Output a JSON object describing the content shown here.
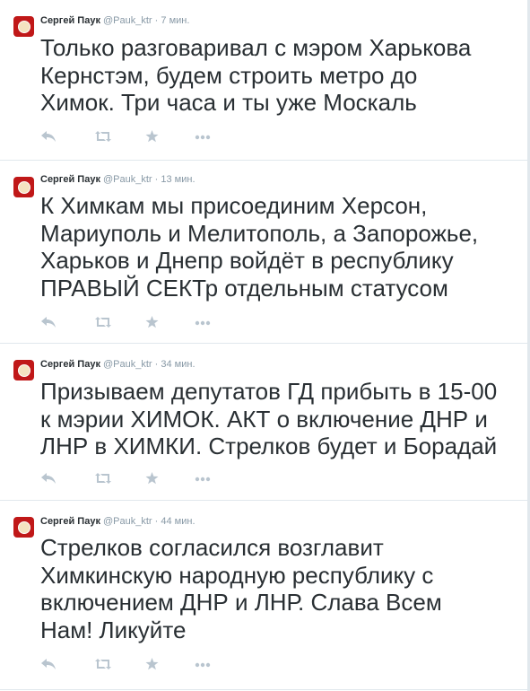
{
  "tweets": [
    {
      "author": "Сергей Паук",
      "handle": "@Pauk_ktr",
      "separator": "·",
      "time": "7 мин.",
      "text": "Только разговаривал с мэром Харькова\nКернстэм, будем строить метро до\nХимок. Три часа и ты уже Москаль"
    },
    {
      "author": "Сергей Паук",
      "handle": "@Pauk_ktr",
      "separator": "·",
      "time": "13 мин.",
      "text": "К Химкам мы присоединим Херсон,\nМариуполь и Мелитополь, а Запорожье,\nХарьков и Днепр войдёт в республику\nПРАВЫЙ СЕКТр отдельным статусом"
    },
    {
      "author": "Сергей Паук",
      "handle": "@Pauk_ktr",
      "separator": "·",
      "time": "34 мин.",
      "text": "Призываем депутатов ГД прибыть в 15-00\nк мэрии ХИМОК. АКТ о включение ДНР и\nЛНР в ХИМКИ. Стрелков будет и Борадай"
    },
    {
      "author": "Сергей Паук",
      "handle": "@Pauk_ktr",
      "separator": "·",
      "time": "44 мин.",
      "text": "Стрелков согласился возглавит\nХимкинскую народную республику с\nвключением ДНР и ЛНР. Слава Всем\nНам! Ликуйте"
    }
  ],
  "icons": {
    "reply": "reply-icon",
    "retweet": "retweet-icon",
    "favorite": "star-icon",
    "more": "more-icon"
  },
  "colors": {
    "text": "#292f33",
    "meta": "#8899a6",
    "action_icon": "#b9c5cf",
    "divider": "#e1e8ed",
    "avatar": "#c01818"
  }
}
